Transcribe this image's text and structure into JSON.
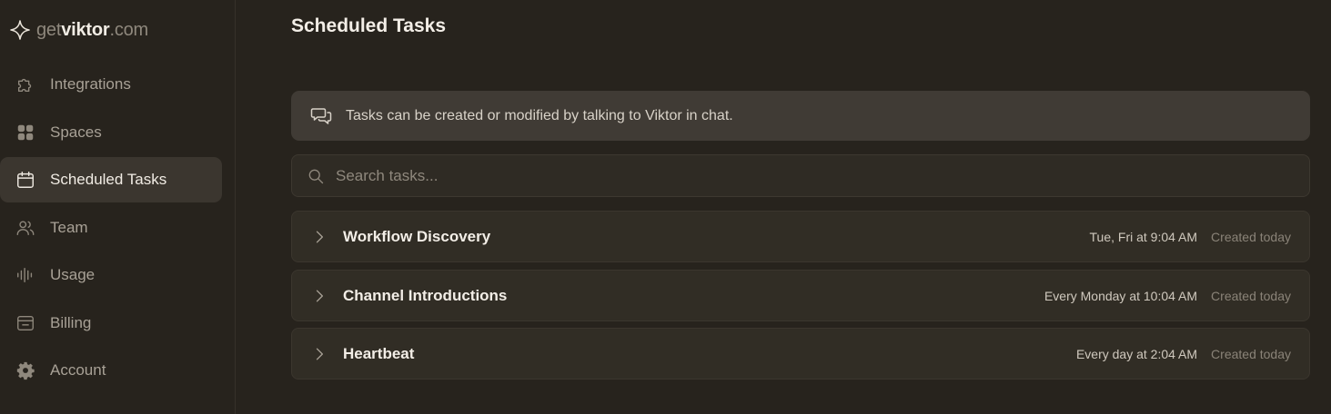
{
  "logo": {
    "part1": "get",
    "part2": "viktor",
    "part3": ".com"
  },
  "sidebar": {
    "items": [
      {
        "label": "Integrations",
        "icon": "puzzle-icon",
        "active": false
      },
      {
        "label": "Spaces",
        "icon": "grid-icon",
        "active": false
      },
      {
        "label": "Scheduled Tasks",
        "icon": "calendar-icon",
        "active": true
      },
      {
        "label": "Team",
        "icon": "users-icon",
        "active": false
      },
      {
        "label": "Usage",
        "icon": "waveform-icon",
        "active": false
      },
      {
        "label": "Billing",
        "icon": "wallet-icon",
        "active": false
      },
      {
        "label": "Account",
        "icon": "gear-icon",
        "active": false
      }
    ]
  },
  "main": {
    "title": "Scheduled Tasks",
    "notice": "Tasks can be created or modified by talking to Viktor in chat.",
    "search": {
      "placeholder": "Search tasks...",
      "value": ""
    },
    "tasks": [
      {
        "name": "Workflow Discovery",
        "schedule": "Tue, Fri at 9:04 AM",
        "created": "Created today"
      },
      {
        "name": "Channel Introductions",
        "schedule": "Every Monday at 10:04 AM",
        "created": "Created today"
      },
      {
        "name": "Heartbeat",
        "schedule": "Every day at 2:04 AM",
        "created": "Created today"
      }
    ]
  },
  "colors": {
    "background": "#27231d",
    "sidebar_active": "#3b362f",
    "notice_bg": "#403b35",
    "row_bg": "#312d25",
    "text_primary": "#f3eee7",
    "text_muted": "#8a8378"
  }
}
